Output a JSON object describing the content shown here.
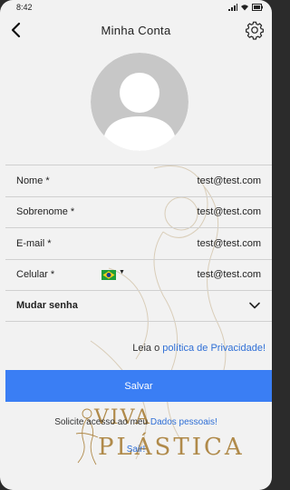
{
  "status": {
    "time": "8:42"
  },
  "header": {
    "title": "Minha Conta"
  },
  "form": {
    "fields": [
      {
        "label": "Nome *",
        "value": "test@test.com"
      },
      {
        "label": "Sobrenome *",
        "value": "test@test.com"
      },
      {
        "label": "E-mail *",
        "value": "test@test.com"
      },
      {
        "label": "Celular *",
        "value": "test@test.com"
      }
    ],
    "password_label": "Mudar senha"
  },
  "privacy": {
    "prefix": "Leia o",
    "link": "política de Privacidade!"
  },
  "save_label": "Salvar",
  "request": {
    "prefix": "Solicite acesso ao meu",
    "link": "Dados pessoais!"
  },
  "logout_label": "Sair!",
  "brand": {
    "line1": "VIVA",
    "line2": "PLÁSTICA"
  },
  "icons": {
    "back": "back-arrow-icon",
    "settings": "gear-icon",
    "flag": "brazil-flag-icon",
    "chevron": "chevron-down-icon"
  },
  "colors": {
    "accent": "#3a7ef4",
    "link": "#2f6fd6",
    "brand_gold": "#b08a4a"
  }
}
